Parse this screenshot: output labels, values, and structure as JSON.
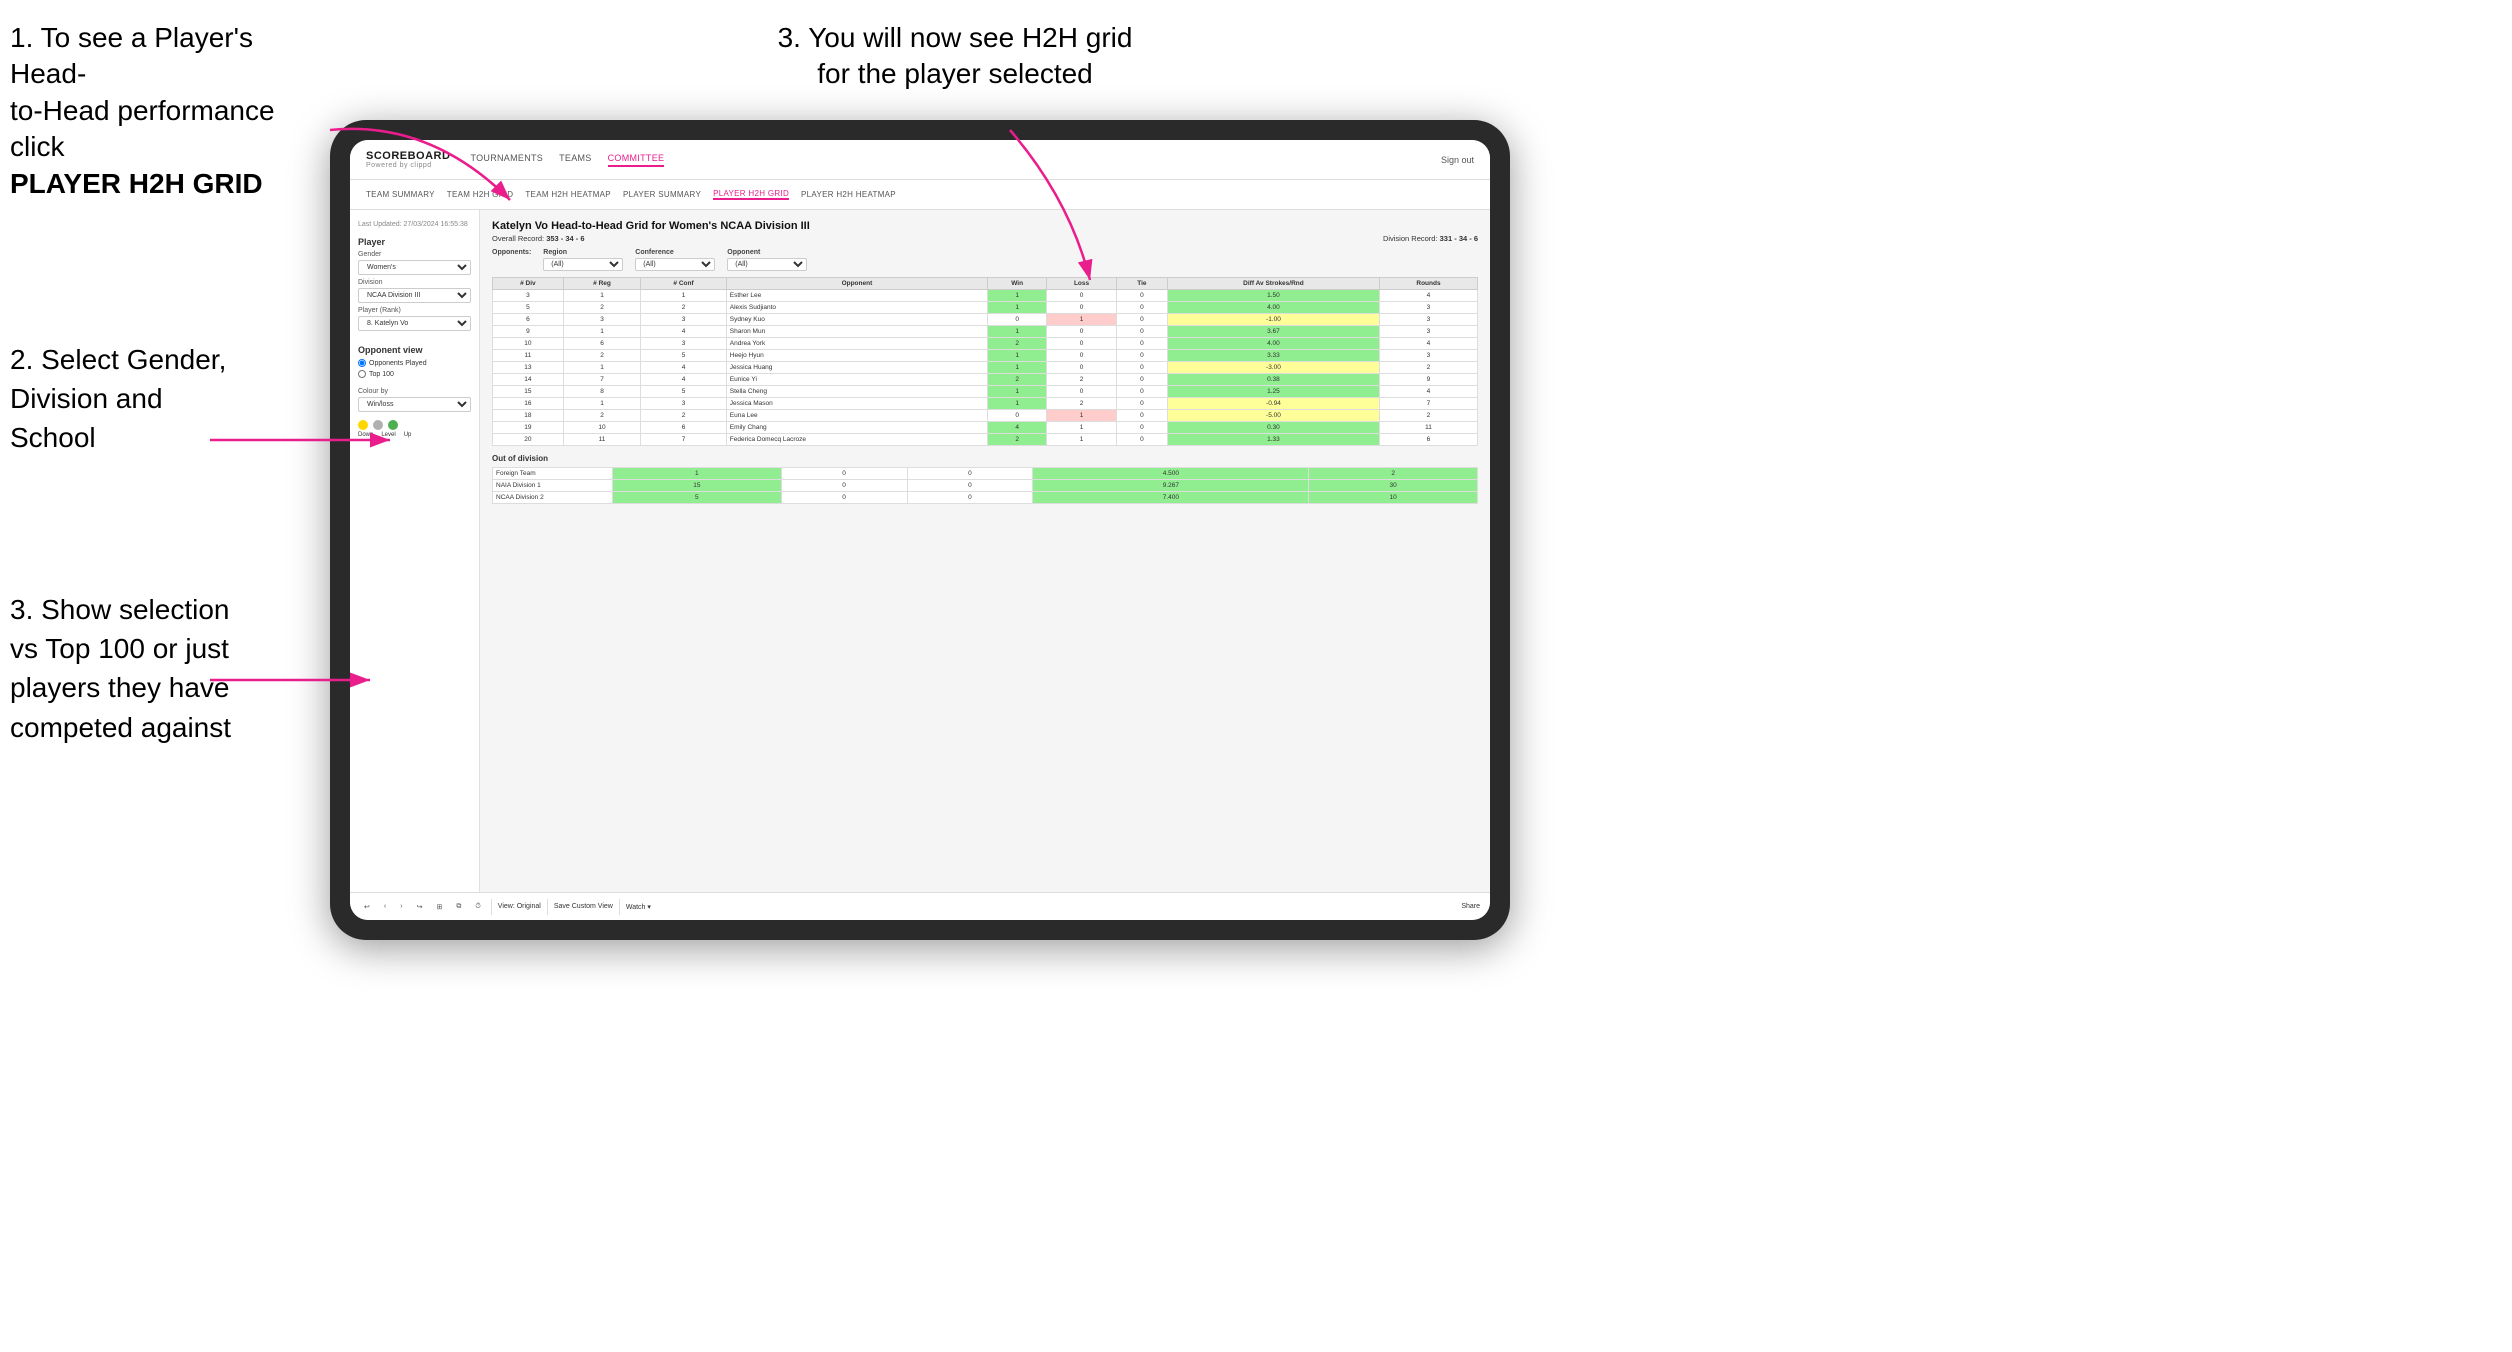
{
  "instructions": {
    "step1_line1": "1. To see a Player's Head-",
    "step1_line2": "to-Head performance click",
    "step1_bold": "PLAYER H2H GRID",
    "step3_top_line1": "3. You will now see H2H grid",
    "step3_top_line2": "for the player selected",
    "step2_line1": "2. Select Gender,",
    "step2_line2": "Division and",
    "step2_line3": "School",
    "step3_bottom_line1": "3. Show selection",
    "step3_bottom_line2": "vs Top 100 or just",
    "step3_bottom_line3": "players they have",
    "step3_bottom_line4": "competed against"
  },
  "nav": {
    "logo": "SCOREBOARD",
    "powered_by": "Powered by clippd",
    "links": [
      "TOURNAMENTS",
      "TEAMS",
      "COMMITTEE"
    ],
    "sign_out": "Sign out",
    "active_link": "COMMITTEE"
  },
  "sub_nav": {
    "links": [
      "TEAM SUMMARY",
      "TEAM H2H GRID",
      "TEAM H2H HEATMAP",
      "PLAYER SUMMARY",
      "PLAYER H2H GRID",
      "PLAYER H2H HEATMAP"
    ],
    "active": "PLAYER H2H GRID"
  },
  "left_panel": {
    "updated": "Last Updated: 27/03/2024\n16:55:38",
    "player_section": "Player",
    "gender_label": "Gender",
    "gender_value": "Women's",
    "division_label": "Division",
    "division_value": "NCAA Division III",
    "player_rank_label": "Player (Rank)",
    "player_rank_value": "8. Katelyn Vo",
    "opponent_view_title": "Opponent view",
    "radio_played": "Opponents Played",
    "radio_top100": "Top 100",
    "colour_by_label": "Colour by",
    "colour_by_value": "Win/loss",
    "down_label": "Down",
    "level_label": "Level",
    "up_label": "Up"
  },
  "grid": {
    "title": "Katelyn Vo Head-to-Head Grid for Women's NCAA Division III",
    "overall_record_label": "Overall Record:",
    "overall_record": "353 - 34 - 6",
    "division_record_label": "Division Record:",
    "division_record": "331 - 34 - 6",
    "filter_opponents_label": "Opponents:",
    "filter_region_label": "Region",
    "filter_conference_label": "Conference",
    "filter_opponent_label": "Opponent",
    "filter_all": "(All)",
    "col_div": "# Div",
    "col_reg": "# Reg",
    "col_conf": "# Conf",
    "col_opponent": "Opponent",
    "col_win": "Win",
    "col_loss": "Loss",
    "col_tie": "Tie",
    "col_diff": "Diff Av Strokes/Rnd",
    "col_rounds": "Rounds",
    "rows": [
      {
        "div": 3,
        "reg": 1,
        "conf": 1,
        "opponent": "Esther Lee",
        "win": 1,
        "loss": 0,
        "tie": 0,
        "diff": 1.5,
        "rounds": 4,
        "win_color": "green"
      },
      {
        "div": 5,
        "reg": 2,
        "conf": 2,
        "opponent": "Alexis Sudjianto",
        "win": 1,
        "loss": 0,
        "tie": 0,
        "diff": 4.0,
        "rounds": 3,
        "win_color": "green"
      },
      {
        "div": 6,
        "reg": 3,
        "conf": 3,
        "opponent": "Sydney Kuo",
        "win": 0,
        "loss": 1,
        "tie": 0,
        "diff": -1.0,
        "rounds": 3,
        "win_color": "yellow"
      },
      {
        "div": 9,
        "reg": 1,
        "conf": 4,
        "opponent": "Sharon Mun",
        "win": 1,
        "loss": 0,
        "tie": 0,
        "diff": 3.67,
        "rounds": 3,
        "win_color": "green"
      },
      {
        "div": 10,
        "reg": 6,
        "conf": 3,
        "opponent": "Andrea York",
        "win": 2,
        "loss": 0,
        "tie": 0,
        "diff": 4.0,
        "rounds": 4,
        "win_color": "green"
      },
      {
        "div": 11,
        "reg": 2,
        "conf": 5,
        "opponent": "Heejo Hyun",
        "win": 1,
        "loss": 0,
        "tie": 0,
        "diff": 3.33,
        "rounds": 3,
        "win_color": "green"
      },
      {
        "div": 13,
        "reg": 1,
        "conf": 4,
        "opponent": "Jessica Huang",
        "win": 1,
        "loss": 0,
        "tie": 0,
        "diff": -3.0,
        "rounds": 2,
        "win_color": "yellow"
      },
      {
        "div": 14,
        "reg": 7,
        "conf": 4,
        "opponent": "Eunice Yi",
        "win": 2,
        "loss": 2,
        "tie": 0,
        "diff": 0.38,
        "rounds": 9,
        "win_color": "yellow"
      },
      {
        "div": 15,
        "reg": 8,
        "conf": 5,
        "opponent": "Stella Cheng",
        "win": 1,
        "loss": 0,
        "tie": 0,
        "diff": 1.25,
        "rounds": 4,
        "win_color": "green"
      },
      {
        "div": 16,
        "reg": 1,
        "conf": 3,
        "opponent": "Jessica Mason",
        "win": 1,
        "loss": 2,
        "tie": 0,
        "diff": -0.94,
        "rounds": 7,
        "win_color": "yellow"
      },
      {
        "div": 18,
        "reg": 2,
        "conf": 2,
        "opponent": "Euna Lee",
        "win": 0,
        "loss": 1,
        "tie": 0,
        "diff": -5.0,
        "rounds": 2,
        "win_color": "red"
      },
      {
        "div": 19,
        "reg": 10,
        "conf": 6,
        "opponent": "Emily Chang",
        "win": 4,
        "loss": 1,
        "tie": 0,
        "diff": 0.3,
        "rounds": 11,
        "win_color": "green"
      },
      {
        "div": 20,
        "reg": 11,
        "conf": 7,
        "opponent": "Federica Domecq Lacroze",
        "win": 2,
        "loss": 1,
        "tie": 0,
        "diff": 1.33,
        "rounds": 6,
        "win_color": "green"
      }
    ],
    "out_of_division_title": "Out of division",
    "out_rows": [
      {
        "label": "Foreign Team",
        "win": 1,
        "loss": 0,
        "tie": 0,
        "diff": 4.5,
        "rounds": 2
      },
      {
        "label": "NAIA Division 1",
        "win": 15,
        "loss": 0,
        "tie": 0,
        "diff": 9.267,
        "rounds": 30
      },
      {
        "label": "NCAA Division 2",
        "win": 5,
        "loss": 0,
        "tie": 0,
        "diff": 7.4,
        "rounds": 10
      }
    ]
  },
  "toolbar": {
    "undo": "↩",
    "redo": "↪",
    "back": "‹",
    "forward": "›",
    "view_original": "View: Original",
    "save_custom": "Save Custom View",
    "watch": "Watch ▾",
    "share": "Share"
  }
}
